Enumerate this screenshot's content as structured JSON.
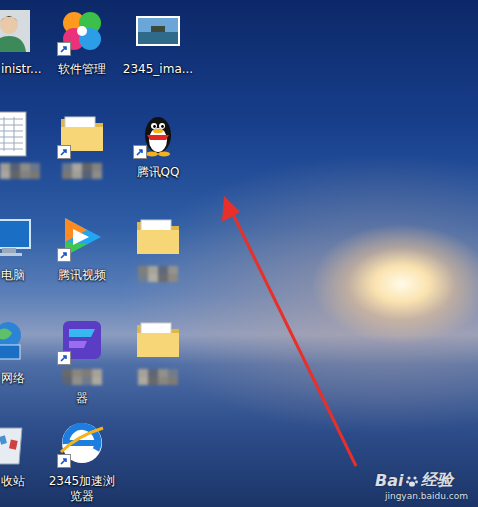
{
  "desktop": {
    "icons": [
      {
        "label": "inistr...",
        "kind": "user",
        "shortcut": false,
        "mosaic": false
      },
      {
        "label": "软件管理",
        "kind": "flower",
        "shortcut": true,
        "mosaic": false
      },
      {
        "label": "2345_ima...",
        "kind": "image",
        "shortcut": false,
        "mosaic": false
      },
      {
        "label": "",
        "kind": "sheet",
        "shortcut": false,
        "mosaic": true
      },
      {
        "label": "",
        "kind": "folder",
        "shortcut": true,
        "mosaic": true
      },
      {
        "label": "腾讯QQ",
        "kind": "qq",
        "shortcut": true,
        "mosaic": false
      },
      {
        "label": "电脑",
        "kind": "computer",
        "shortcut": false,
        "mosaic": false
      },
      {
        "label": "腾讯视频",
        "kind": "video",
        "shortcut": true,
        "mosaic": false
      },
      {
        "label": "",
        "kind": "folder",
        "shortcut": false,
        "mosaic": true
      },
      {
        "label": "网络",
        "kind": "network",
        "shortcut": false,
        "mosaic": false
      },
      {
        "label": "器",
        "kind": "app",
        "shortcut": true,
        "mosaic": true
      },
      {
        "label": "",
        "kind": "folder",
        "shortcut": false,
        "mosaic": true
      },
      {
        "label": "收站",
        "kind": "recycle",
        "shortcut": false,
        "mosaic": false
      },
      {
        "label": "2345加速浏览器",
        "kind": "browser",
        "shortcut": true,
        "mosaic": false
      }
    ]
  },
  "watermark": {
    "brand": "Bai",
    "product": "经验",
    "url": "jingyan.baidu.com"
  }
}
